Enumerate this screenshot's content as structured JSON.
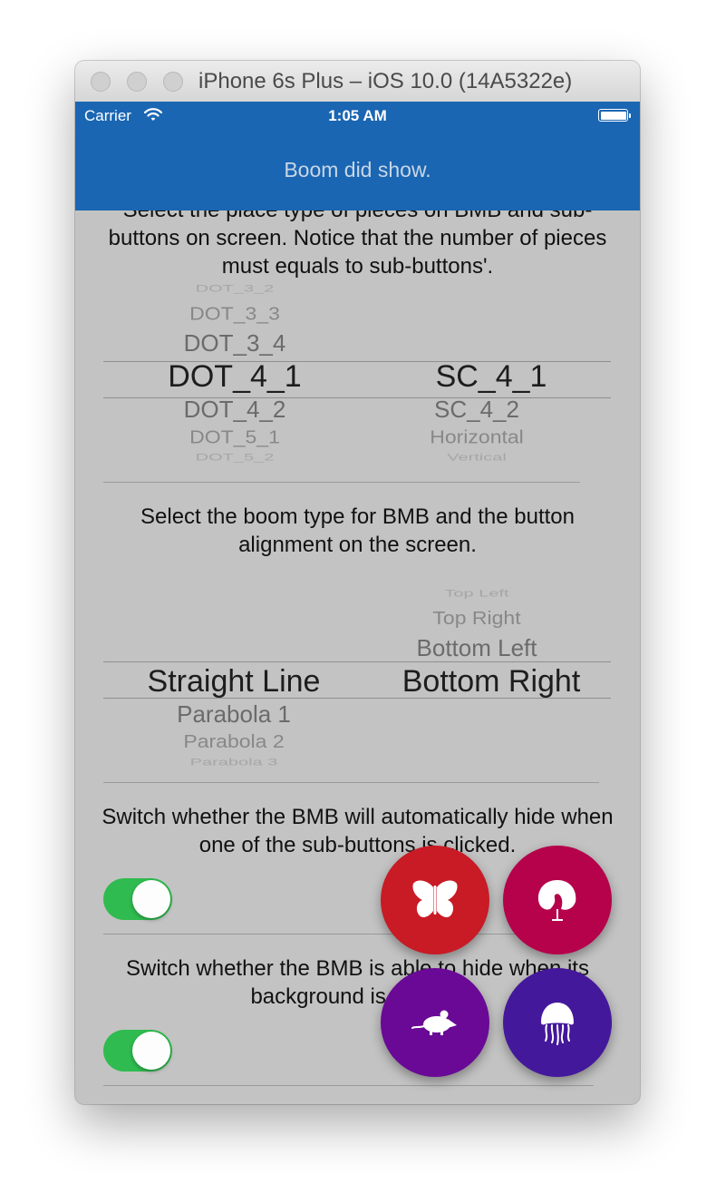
{
  "window": {
    "title": "iPhone 6s Plus – iOS 10.0 (14A5322e)"
  },
  "status_bar": {
    "carrier": "Carrier",
    "time": "1:05 AM"
  },
  "nav": {
    "title": "Boom did show."
  },
  "section1": {
    "description": "Select the place type of pieces on BMB and sub-buttons on screen. Notice that the number of pieces must equals to sub-buttons'.",
    "picker_left": {
      "above3": "DOT_3_2",
      "above2": "DOT_3_3",
      "above1": "DOT_3_4",
      "selected": "DOT_4_1",
      "below1": "DOT_4_2",
      "below2": "DOT_5_1",
      "below3": "DOT_5_2"
    },
    "picker_right": {
      "selected": "SC_4_1",
      "below1": "SC_4_2",
      "below2": "Horizontal",
      "below3": "Vertical"
    }
  },
  "section2": {
    "description": "Select the boom type for BMB and the button alignment on the screen.",
    "picker_left": {
      "selected": "Straight Line",
      "below1": "Parabola 1",
      "below2": "Parabola 2",
      "below3": "Parabola 3"
    },
    "picker_right": {
      "above3": "Top Left",
      "above2": "Top Right",
      "above1": "Bottom Left",
      "selected": "Bottom Right"
    }
  },
  "section3": {
    "description": "Switch whether the BMB will automatically hide when one of the sub-buttons is clicked.",
    "toggle_on": true
  },
  "section4": {
    "description": "Switch whether the BMB is able to hide when its background is clicked.",
    "toggle_on": true
  },
  "boom_buttons": [
    {
      "icon": "butterfly-icon",
      "color": "#c81b25"
    },
    {
      "icon": "peacock-icon",
      "color": "#b5024b"
    },
    {
      "icon": "mouse-icon",
      "color": "#6a0996"
    },
    {
      "icon": "jellyfish-icon",
      "color": "#44189b"
    }
  ],
  "colors": {
    "nav_bar": "#1a66b3",
    "background": "#c3c3c3",
    "switch_on": "#2fbb4f",
    "bmb_button": "#1e5fb0"
  }
}
